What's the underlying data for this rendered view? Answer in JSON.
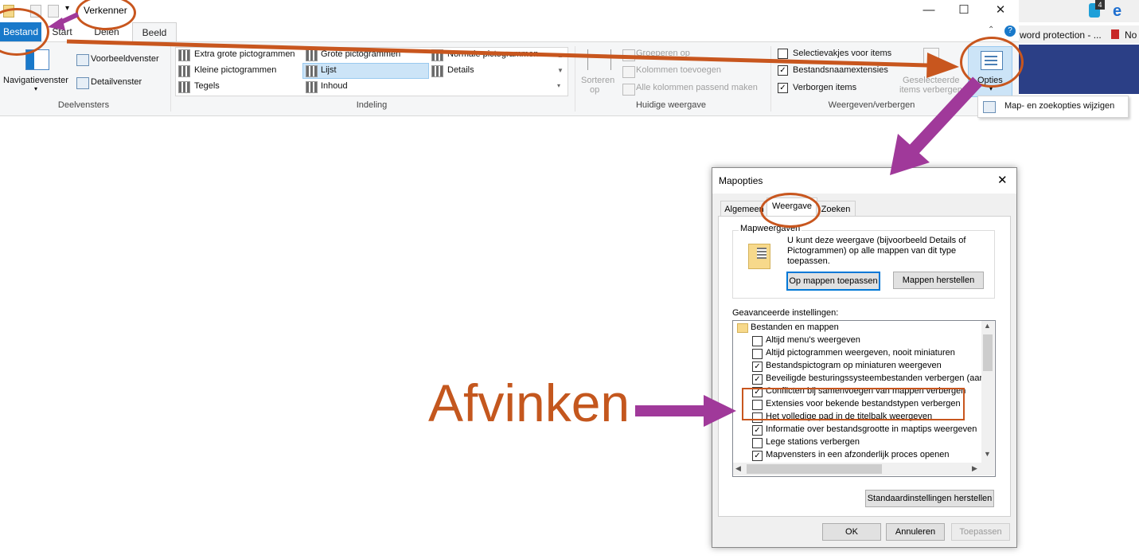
{
  "explorer": {
    "title": "Verkenner",
    "window_controls": [
      "—",
      "☐",
      "✕"
    ],
    "tabs": [
      "Bestand",
      "Start",
      "Delen",
      "Beeld"
    ],
    "panes": {
      "navigatievenster": "Navigatievenster",
      "voorbeeldvenster": "Voorbeeldvenster",
      "detailvenster": "Detailvenster",
      "group_label": "Deelvensters"
    },
    "layout": {
      "items": [
        "Extra grote pictogrammen",
        "Grote pictogrammen",
        "Normale pictogrammen",
        "Kleine pictogrammen",
        "Lijst",
        "Details",
        "Tegels",
        "Inhoud"
      ],
      "selected": "Lijst",
      "group_label": "Indeling"
    },
    "current_view": {
      "sort": "Sorteren",
      "sort_op": "op",
      "group_by": "Groeperen op",
      "add_columns": "Kolommen toevoegen",
      "fit_columns": "Alle kolommen passend maken",
      "group_label": "Huidige weergave"
    },
    "show_hide": {
      "checkboxes": [
        {
          "label": "Selectievakjes voor items",
          "checked": false
        },
        {
          "label": "Bestandsnaamextensies",
          "checked": true
        },
        {
          "label": "Verborgen items",
          "checked": true
        }
      ],
      "hide_selected_1": "Geselecteerde",
      "hide_selected_2": "items verbergen",
      "group_label": "Weergeven/verbergen"
    },
    "options_label": "Opties",
    "options_tooltip": "Map- en zoekopties wijzigen"
  },
  "taskbar": {
    "badge": "4",
    "tab1": "word protection - ...",
    "tab2": "No"
  },
  "dialog": {
    "title": "Mapopties",
    "tabs": [
      "Algemeen",
      "Weergave",
      "Zoeken"
    ],
    "active_tab": "Weergave",
    "mapweergaven": {
      "title": "Mapweergaven",
      "text_line1": "U kunt deze weergave (bijvoorbeeld Details of",
      "text_line2": "Pictogrammen) op alle mappen van dit type",
      "text_line3": "toepassen.",
      "apply_button": "Op mappen toepassen",
      "reset_button": "Mappen herstellen"
    },
    "advanced_label": "Geavanceerde instellingen:",
    "tree_root": "Bestanden en mappen",
    "settings": [
      {
        "label": "Altijd menu's weergeven",
        "checked": false
      },
      {
        "label": "Altijd pictogrammen weergeven, nooit miniaturen",
        "checked": false
      },
      {
        "label": "Bestandspictogram op miniaturen weergeven",
        "checked": true
      },
      {
        "label": "Beveiligde besturingssysteembestanden verbergen (aanb",
        "checked": true
      },
      {
        "label": "Conflicten bij samenvoegen van mappen verbergen",
        "checked": true
      },
      {
        "label": "Extensies voor bekende bestandstypen verbergen",
        "checked": false
      },
      {
        "label": "Het volledige pad in de titelbalk weergeven",
        "checked": false
      },
      {
        "label": "Informatie over bestandsgrootte in maptips weergeven",
        "checked": true
      },
      {
        "label": "Lege stations verbergen",
        "checked": false
      },
      {
        "label": "Mapvensters in een afzonderlijk proces openen",
        "checked": true
      }
    ],
    "restore_defaults": "Standaardinstellingen herstellen",
    "ok": "OK",
    "cancel": "Annuleren",
    "apply": "Toepassen"
  },
  "annotation": {
    "text": "Afvinken",
    "color": "#c4571e",
    "arrow_orange": "#c8561e",
    "arrow_purple": "#a0399a"
  }
}
